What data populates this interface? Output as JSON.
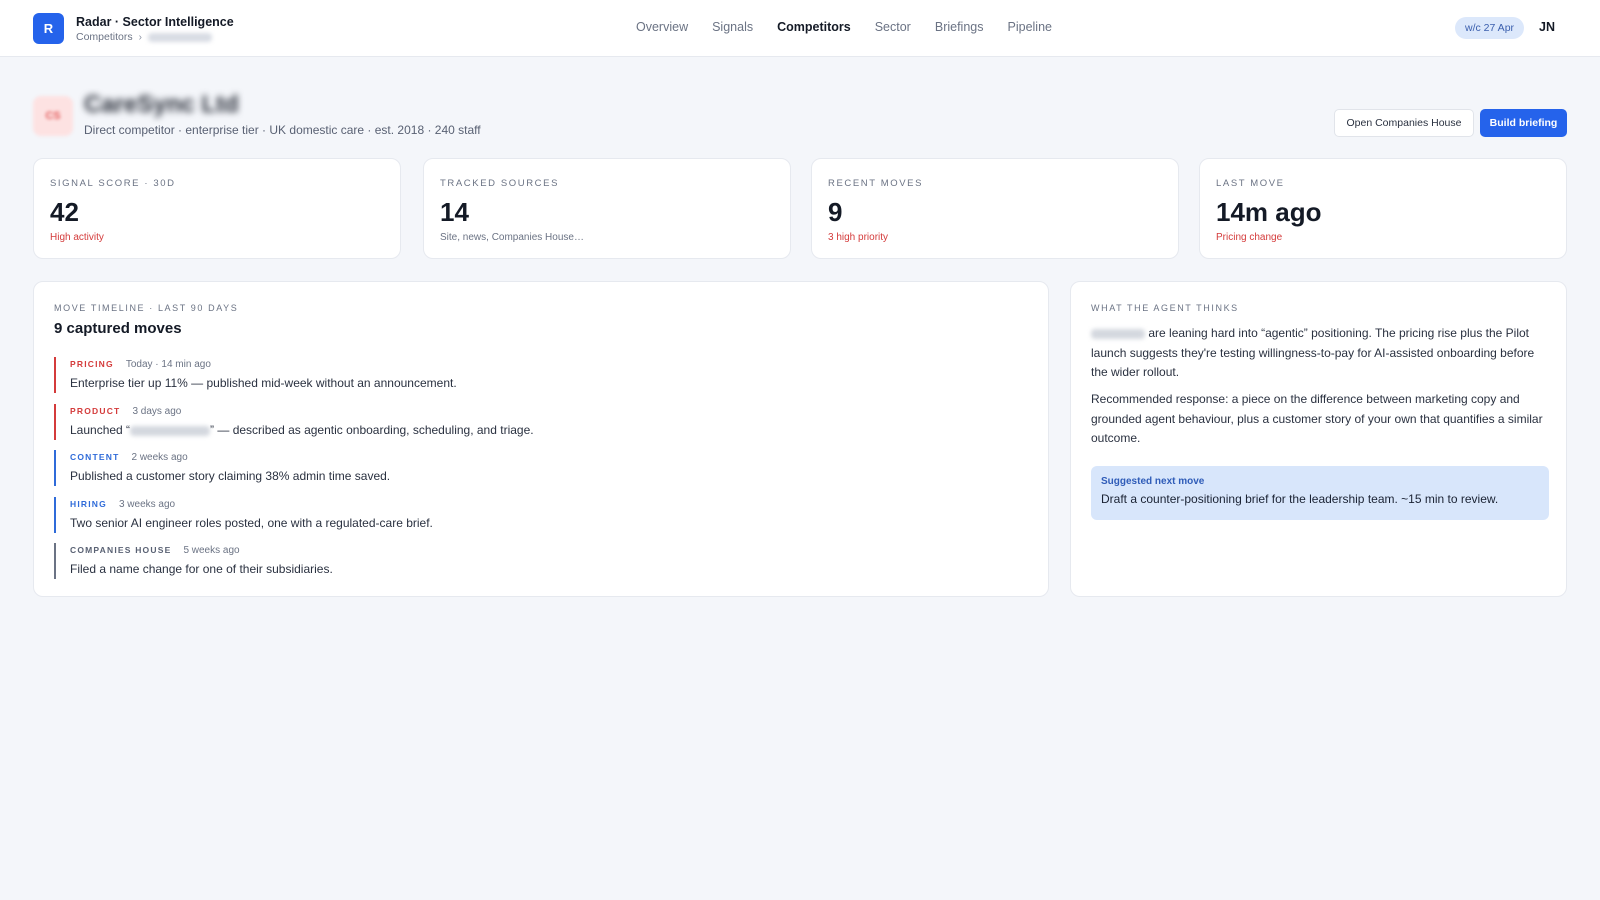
{
  "app": {
    "logo_letter": "R",
    "title": "Radar · Sector Intelligence",
    "breadcrumb_root": "Competitors",
    "breadcrumb_sep": "›"
  },
  "nav": {
    "items": [
      "Overview",
      "Signals",
      "Competitors",
      "Sector",
      "Briefings",
      "Pipeline"
    ],
    "active": "Competitors"
  },
  "header_right": {
    "week": "w/c 27 Apr",
    "avatar": "JN"
  },
  "company": {
    "logo_text": "CS",
    "name": "CareSync Ltd",
    "subtitle": "Direct competitor · enterprise tier · UK domestic care · est. 2018 · 240 staff",
    "open_ch_label": "Open Companies House",
    "build_label": "Build briefing"
  },
  "stats": [
    {
      "label": "SIGNAL SCORE · 30D",
      "value": "42",
      "note": "High activity",
      "tone": "red"
    },
    {
      "label": "TRACKED SOURCES",
      "value": "14",
      "note": "Site, news, Companies House…",
      "tone": "gray"
    },
    {
      "label": "RECENT MOVES",
      "value": "9",
      "note": "3 high priority",
      "tone": "red"
    },
    {
      "label": "LAST MOVE",
      "value": "14m ago",
      "note": "Pricing change",
      "tone": "red"
    }
  ],
  "timeline": {
    "label": "MOVE TIMELINE · LAST 90 DAYS",
    "heading": "9 captured moves",
    "moves": [
      {
        "tag": "PRICING",
        "time": "Today · 14 min ago",
        "text": "Enterprise tier up 11% — published mid-week without an announcement.",
        "tone": "red"
      },
      {
        "tag": "PRODUCT",
        "time": "3 days ago",
        "text_pre": "Launched “",
        "text_post": "” — described as agentic onboarding, scheduling, and triage.",
        "tone": "red"
      },
      {
        "tag": "CONTENT",
        "time": "2 weeks ago",
        "text": "Published a customer story claiming 38% admin time saved.",
        "tone": "blue"
      },
      {
        "tag": "HIRING",
        "time": "3 weeks ago",
        "text": "Two senior AI engineer roles posted, one with a regulated-care brief.",
        "tone": "blue"
      },
      {
        "tag": "COMPANIES HOUSE",
        "time": "5 weeks ago",
        "text": "Filed a name change for one of their subsidiaries.",
        "tone": "gray"
      }
    ]
  },
  "agent": {
    "label": "WHAT THE AGENT THINKS",
    "para1": "are leaning hard into “agentic” positioning. The pricing rise plus the Pilot launch suggests they're testing willingness-to-pay for AI-assisted onboarding before the wider rollout.",
    "para2": "Recommended response: a piece on the difference between marketing copy and grounded agent behaviour, plus a customer story of your own that quantifies a similar outcome.",
    "suggest_title": "Suggested next move",
    "suggest_text": "Draft a counter-positioning brief for the leadership team. ~15 min to review."
  },
  "colors": {
    "accent": "#2563eb",
    "danger": "#d43b3b",
    "info": "#2f6bd9",
    "muted": "#6b7384",
    "background": "#f4f6fa"
  }
}
